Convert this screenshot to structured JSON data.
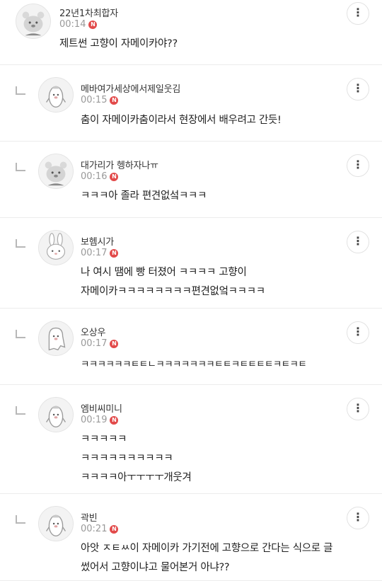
{
  "comments": [
    {
      "nickname": "22년1차최합자",
      "time": "00:14",
      "badge": "N",
      "text": "제트썬 고향이 자메이카야??",
      "avatar": "bear-avatar-icon",
      "reply": false
    },
    {
      "nickname": "메바여가세상에서제일웃김",
      "time": "00:15",
      "badge": "N",
      "text": "춤이 자메이카춤이라서 현장에서 배우려고 간듯!",
      "avatar": "penguin-avatar-icon",
      "reply": true
    },
    {
      "nickname": "대가리가 헹하자나ㅠ",
      "time": "00:16",
      "badge": "N",
      "text": "ㅋㅋㅋ아 졸라 편견없섴ㅋㅋㅋ",
      "avatar": "bear-avatar-icon",
      "reply": true
    },
    {
      "nickname": "보헴시가",
      "time": "00:17",
      "badge": "N",
      "text": "나 여시 땜에 빵 터졌어 ㅋㅋㅋㅋ 고향이\n자메이카ㅋㅋㅋㅋㅋㅋㅋㅋ편견없엌ㅋㅋㅋㅋ",
      "avatar": "rabbit-avatar-icon",
      "reply": true
    },
    {
      "nickname": "오상우",
      "time": "00:17",
      "badge": "N",
      "text": "ㅋㅋㅋㅋㅋㅋㅌㅌㄴㅋㅋㅋㅋㅋㅋㅋㅌㅌㅋㅌㅌㅌㅌㅋㅌㅋㅌ",
      "avatar": "ghost-avatar-icon",
      "reply": true
    },
    {
      "nickname": "엠비씨미니",
      "time": "00:19",
      "badge": "N",
      "text": "ㅋㅋㅋㅋㅋ\nㅋㅋㅋㅋㅋㅋㅋㅋㅋㅋ\nㅋㅋㅋㅋ아ㅜㅜㅜㅜ개웃겨",
      "avatar": "penguin-avatar-icon",
      "reply": true
    },
    {
      "nickname": "곽빈",
      "time": "00:21",
      "badge": "N",
      "text": "아앗 ㅈㅌㅆ이 자메이카 가기전에 고향으로 간다는 식으로 글\n썼어서 고향이냐고 물어본거 아냐??",
      "avatar": "penguin-avatar-icon",
      "reply": true
    }
  ],
  "more_label": "⋮"
}
